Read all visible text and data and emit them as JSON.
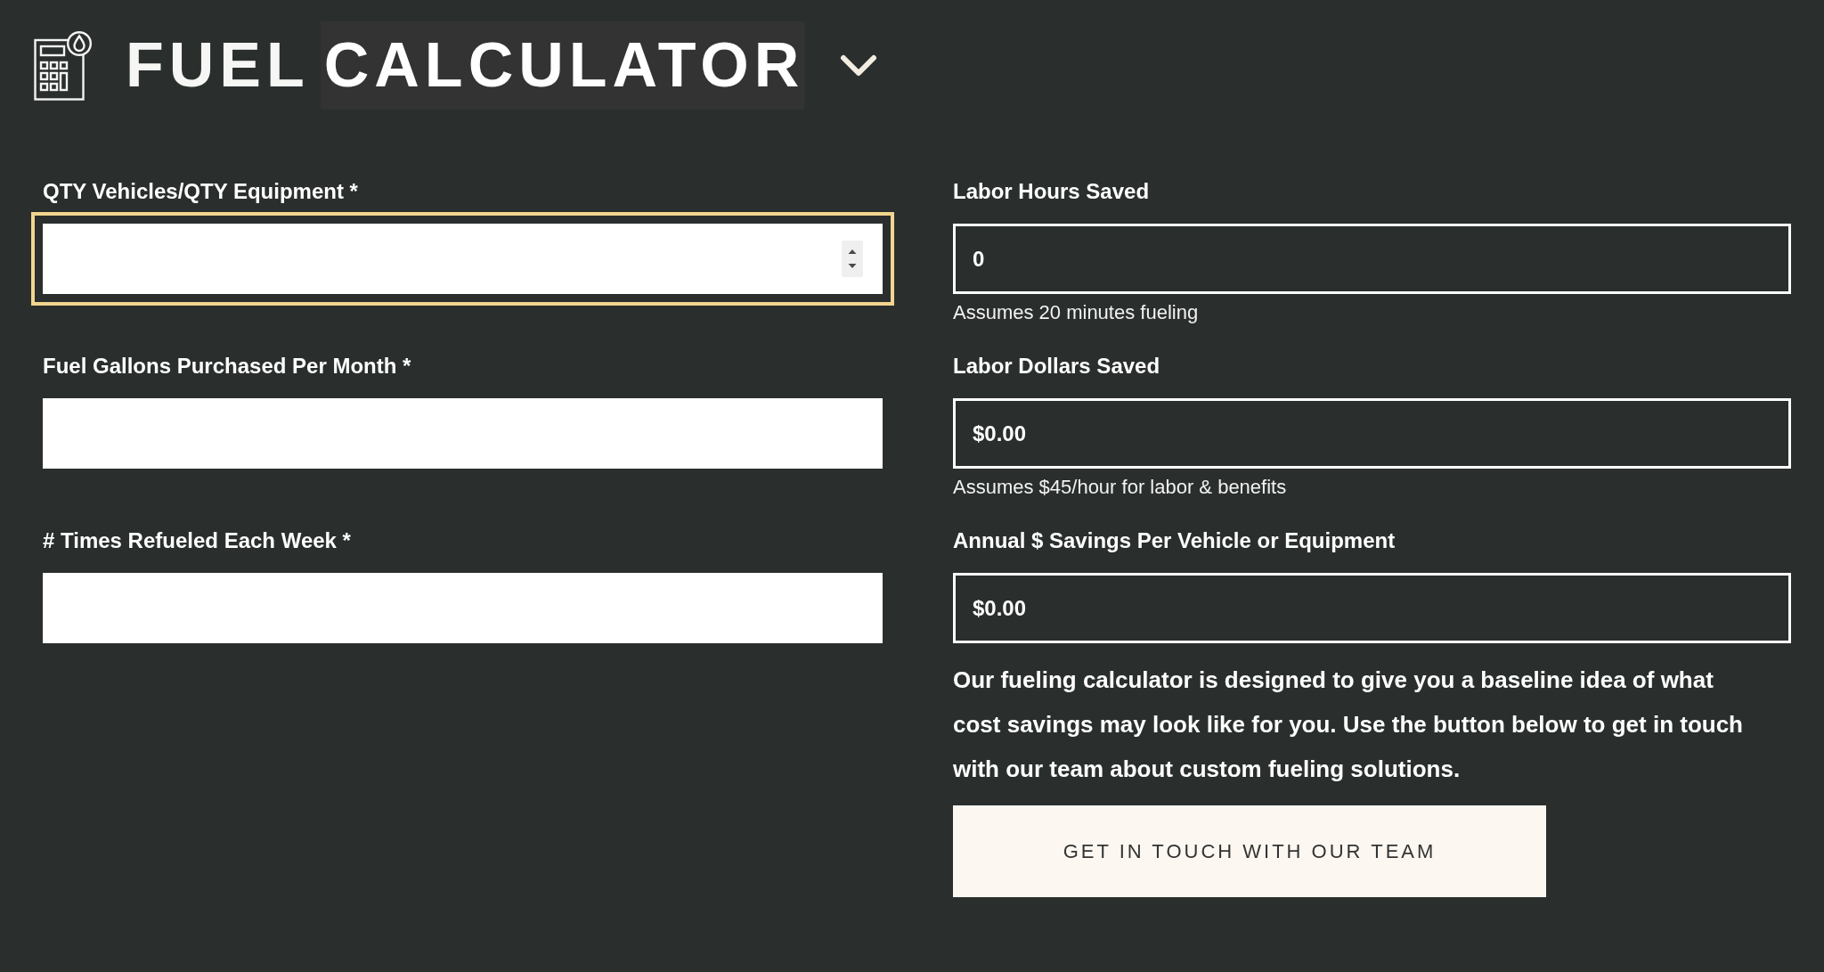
{
  "header": {
    "title": [
      {
        "text": "FUEL",
        "highlighted": false
      },
      {
        "text": "CALCULATOR",
        "highlighted": true
      }
    ]
  },
  "inputs": [
    {
      "label": "QTY Vehicles/QTY Equipment *",
      "focused": true
    },
    {
      "label": "Fuel Gallons Purchased Per Month *",
      "focused": false
    },
    {
      "label": "# Times Refueled Each Week *",
      "focused": false
    }
  ],
  "results": [
    {
      "label": "Labor Hours Saved",
      "value": "0",
      "note": "Assumes 20 minutes fueling"
    },
    {
      "label": "Labor Dollars Saved",
      "value": "$0.00",
      "note": "Assumes $45/hour for labor & benefits"
    },
    {
      "label": "Annual $ Savings Per Vehicle or Equipment",
      "value": "$0.00"
    }
  ],
  "description": "Our fueling calculator is designed to give you a baseline idea of what cost savings may look like for you. Use the button below to get in touch with our team about custom fueling solutions.",
  "contact_button": "GET IN TOUCH WITH OUR TEAM"
}
